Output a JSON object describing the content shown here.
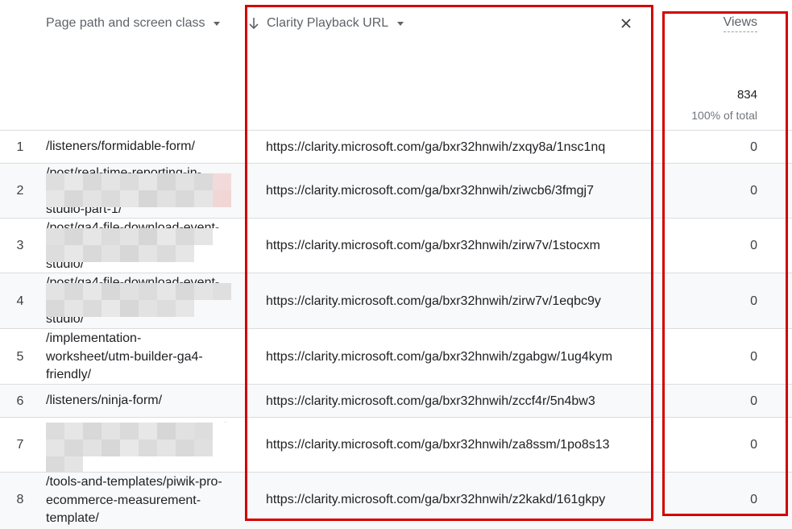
{
  "header": {
    "col_page_path": "Page path and screen class",
    "col_clarity": "Clarity Playback URL",
    "col_views": "Views",
    "total_views": "834",
    "total_pct": "100% of total"
  },
  "icons": {
    "sort": "arrow-down-icon",
    "dropdown": "caret-down-icon",
    "remove": "close-icon"
  },
  "colors": {
    "highlight": "#d40000",
    "alt_row": "#f8f9fa",
    "divider": "#dadce0"
  },
  "rows": [
    {
      "index": "1",
      "path": "/listeners/formidable-form/",
      "url": "https://clarity.microsoft.com/ga/bxr32hnwih/zxqy8a/1nsc1nq",
      "views": "0",
      "redacted": false
    },
    {
      "index": "2",
      "path": "/post/real-time-reporting-in-\n\nstudio-part-1/",
      "url": "https://clarity.microsoft.com/ga/bxr32hnwih/ziwcb6/3fmgj7",
      "views": "0",
      "redacted": true
    },
    {
      "index": "3",
      "path": "/post/ga4-file-download-event-\n\nstudio/",
      "url": "https://clarity.microsoft.com/ga/bxr32hnwih/zirw7v/1stocxm",
      "views": "0",
      "redacted": true
    },
    {
      "index": "4",
      "path": "/post/ga4-file-download-event-\n\nstudio/",
      "url": "https://clarity.microsoft.com/ga/bxr32hnwih/zirw7v/1eqbc9y",
      "views": "0",
      "redacted": true
    },
    {
      "index": "5",
      "path": "/implementation-\nworksheet/utm-builder-ga4-\nfriendly/",
      "url": "https://clarity.microsoft.com/ga/bxr32hnwih/zgabgw/1ug4kym",
      "views": "0",
      "redacted": false
    },
    {
      "index": "6",
      "path": "/listeners/ninja-form/",
      "url": "https://clarity.microsoft.com/ga/bxr32hnwih/zccf4r/5n4bw3",
      "views": "0",
      "redacted": false
    },
    {
      "index": "7",
      "path": "t-\n\n",
      "url": "https://clarity.microsoft.com/ga/bxr32hnwih/za8ssm/1po8s13",
      "views": "0",
      "redacted": true
    },
    {
      "index": "8",
      "path": "/tools-and-templates/piwik-pro-\necommerce-measurement-\ntemplate/",
      "url": "https://clarity.microsoft.com/ga/bxr32hnwih/z2kakd/161gkpy",
      "views": "0",
      "redacted": false
    }
  ]
}
